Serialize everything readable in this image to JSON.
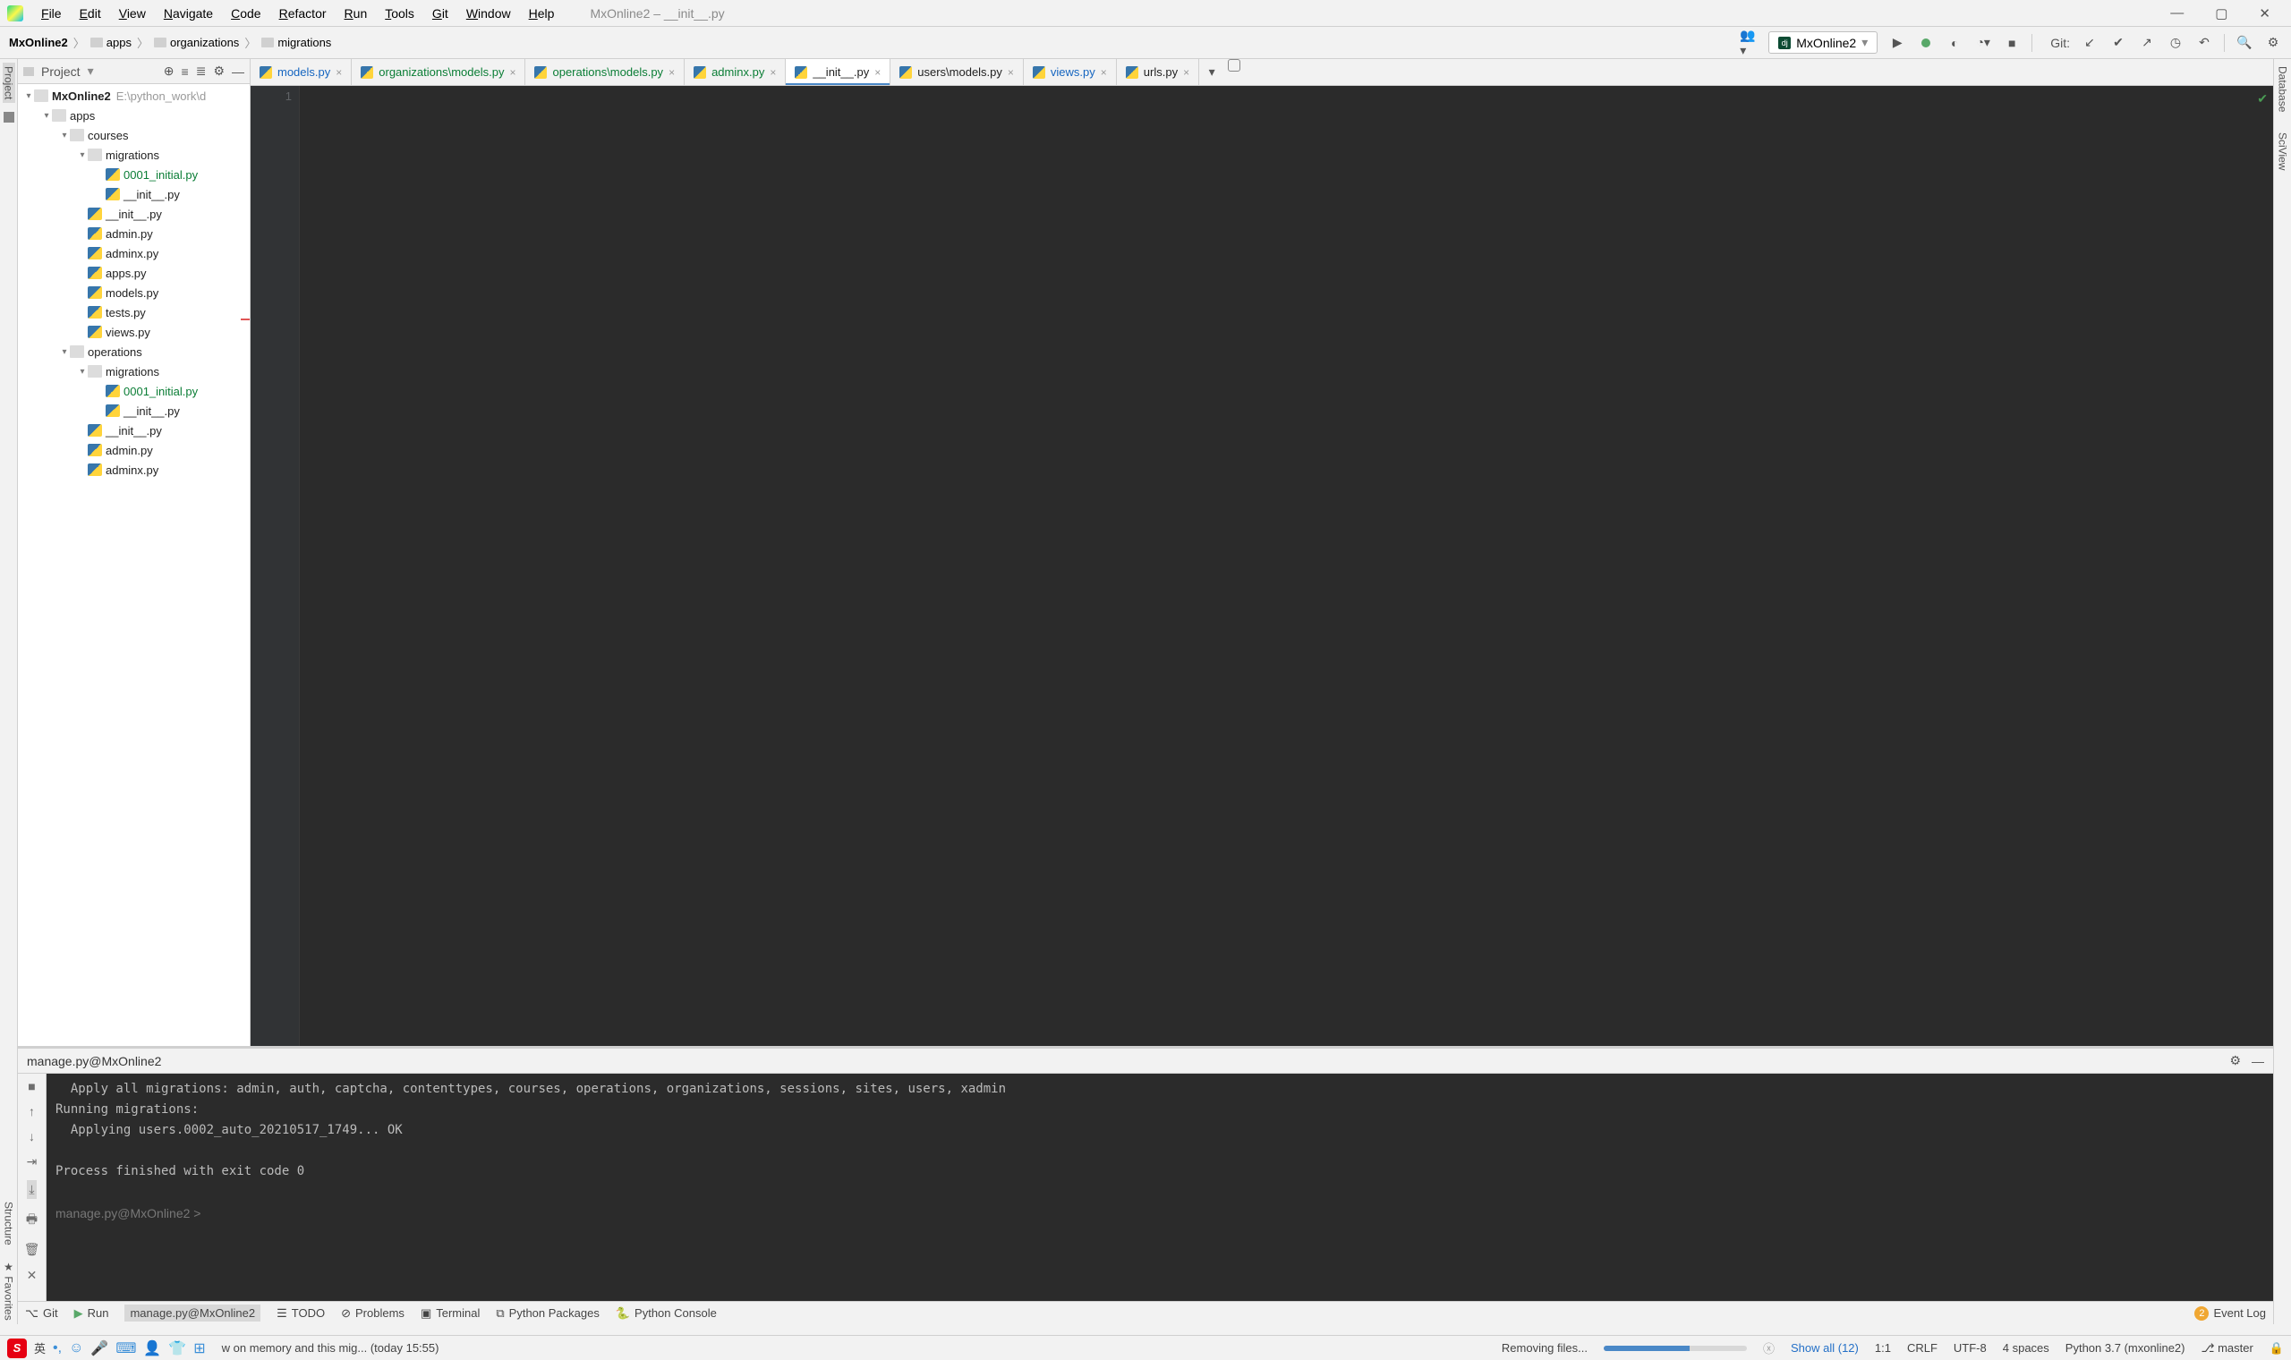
{
  "window": {
    "title": "MxOnline2 – __init__.py"
  },
  "menu": [
    "File",
    "Edit",
    "View",
    "Navigate",
    "Code",
    "Refactor",
    "Run",
    "Tools",
    "Git",
    "Window",
    "Help"
  ],
  "breadcrumbs": [
    "MxOnline2",
    "apps",
    "organizations",
    "migrations"
  ],
  "run_config": "MxOnline2",
  "git_label": "Git:",
  "left_tools": {
    "project": "Project",
    "structure": "Structure",
    "favorites": "Favorites"
  },
  "right_tools": {
    "database": "Database",
    "sciview": "SciView"
  },
  "project_panel": {
    "label": "Project",
    "root": {
      "name": "MxOnline2",
      "path": "E:\\python_work\\d"
    },
    "tree": [
      {
        "name": "apps",
        "type": "fld",
        "indent": 1,
        "open": true
      },
      {
        "name": "courses",
        "type": "fld",
        "indent": 2,
        "open": true
      },
      {
        "name": "migrations",
        "type": "fld",
        "indent": 3,
        "open": true
      },
      {
        "name": "0001_initial.py",
        "type": "py",
        "indent": 4,
        "cls": "green"
      },
      {
        "name": "__init__.py",
        "type": "py",
        "indent": 4
      },
      {
        "name": "__init__.py",
        "type": "py",
        "indent": 3
      },
      {
        "name": "admin.py",
        "type": "py",
        "indent": 3
      },
      {
        "name": "adminx.py",
        "type": "py",
        "indent": 3
      },
      {
        "name": "apps.py",
        "type": "py",
        "indent": 3
      },
      {
        "name": "models.py",
        "type": "py",
        "indent": 3
      },
      {
        "name": "tests.py",
        "type": "py",
        "indent": 3
      },
      {
        "name": "views.py",
        "type": "py",
        "indent": 3
      },
      {
        "name": "operations",
        "type": "fld",
        "indent": 2,
        "open": true
      },
      {
        "name": "migrations",
        "type": "fld",
        "indent": 3,
        "open": true
      },
      {
        "name": "0001_initial.py",
        "type": "py",
        "indent": 4,
        "cls": "green"
      },
      {
        "name": "__init__.py",
        "type": "py",
        "indent": 4
      },
      {
        "name": "__init__.py",
        "type": "py",
        "indent": 3
      },
      {
        "name": "admin.py",
        "type": "py",
        "indent": 3
      },
      {
        "name": "adminx.py",
        "type": "py",
        "indent": 3
      }
    ]
  },
  "tabs": [
    {
      "name": "models.py",
      "cls": "blue"
    },
    {
      "name": "organizations\\models.py",
      "cls": "green"
    },
    {
      "name": "operations\\models.py",
      "cls": "green"
    },
    {
      "name": "adminx.py",
      "cls": "green"
    },
    {
      "name": "__init__.py",
      "cls": "",
      "active": true
    },
    {
      "name": "users\\models.py",
      "cls": ""
    },
    {
      "name": "views.py",
      "cls": "blue"
    },
    {
      "name": "urls.py",
      "cls": ""
    }
  ],
  "editor": {
    "line": "1"
  },
  "run_panel": {
    "title": "manage.py@MxOnline2",
    "lines": [
      "  Apply all migrations: admin, auth, captcha, contenttypes, courses, operations, organizations, sessions, sites, users, xadmin",
      "Running migrations:",
      "  Applying users.0002_auto_20210517_1749... OK",
      "",
      "Process finished with exit code 0",
      ""
    ],
    "prompt": "manage.py@MxOnline2 > "
  },
  "bottom_tabs": {
    "git": "Git",
    "run": "Run",
    "manage": "manage.py@MxOnline2",
    "todo": "TODO",
    "problems": "Problems",
    "terminal": "Terminal",
    "pypkg": "Python Packages",
    "pycon": "Python Console",
    "eventlog": "Event Log",
    "event_badge": "2"
  },
  "status": {
    "ime_lang": "英",
    "bg_task": "w on memory and this mig... (today 15:55)",
    "removing": "Removing files...",
    "showall": "Show all (12)",
    "pos": "1:1",
    "eol": "CRLF",
    "enc": "UTF-8",
    "indent": "4 spaces",
    "interp": "Python 3.7 (mxonline2)",
    "branch": "master"
  }
}
